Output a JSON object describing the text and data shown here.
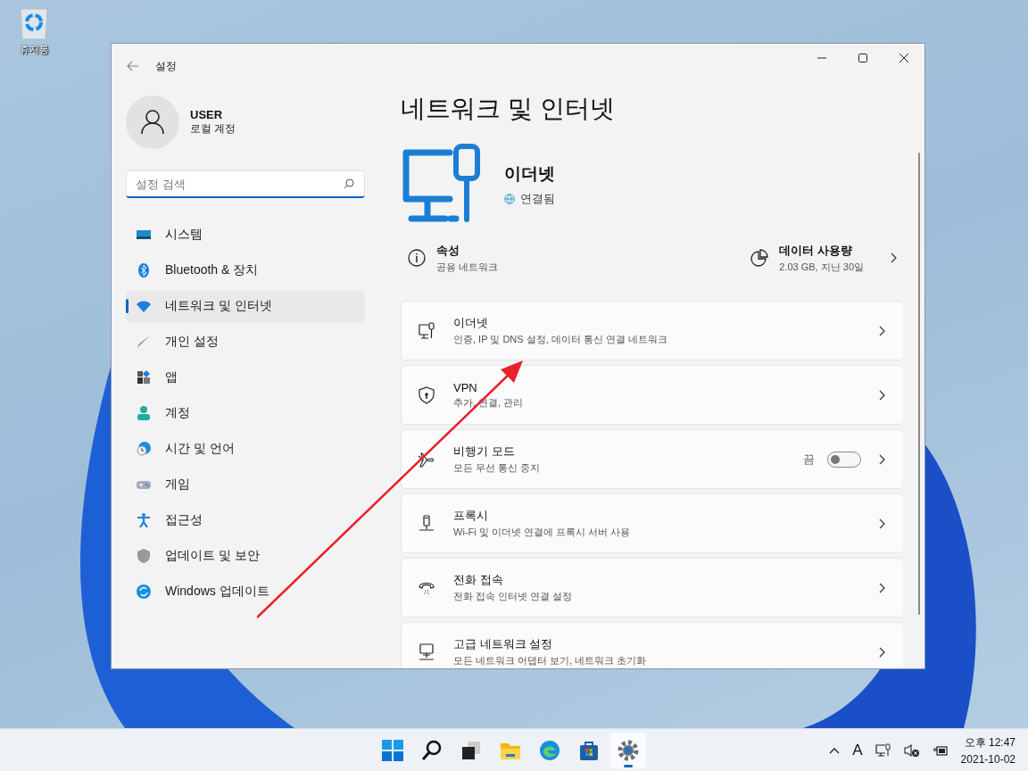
{
  "desktop": {
    "icons": [
      {
        "label": "휴지통"
      }
    ]
  },
  "window": {
    "title": "설정",
    "user": {
      "name": "USER",
      "account": "로컬 계정"
    },
    "search": {
      "placeholder": "설정 검색"
    },
    "nav": [
      {
        "label": "시스템",
        "selected": false
      },
      {
        "label": "Bluetooth & 장치",
        "selected": false
      },
      {
        "label": "네트워크 및 인터넷",
        "selected": true
      },
      {
        "label": "개인 설정",
        "selected": false
      },
      {
        "label": "앱",
        "selected": false
      },
      {
        "label": "계정",
        "selected": false
      },
      {
        "label": "시간 및 언어",
        "selected": false
      },
      {
        "label": "게임",
        "selected": false
      },
      {
        "label": "접근성",
        "selected": false
      },
      {
        "label": "업데이트 및 보안",
        "selected": false
      },
      {
        "label": "Windows 업데이트",
        "selected": false
      }
    ],
    "page_title": "네트워크 및 인터넷",
    "hero": {
      "name": "이더넷",
      "status": "연결됨"
    },
    "properties": {
      "title": "속성",
      "subtitle": "공용 네트워크"
    },
    "data_usage": {
      "title": "데이터 사용량",
      "subtitle": "2.03 GB, 지난 30일"
    },
    "settings": [
      {
        "kind": "link",
        "title": "이더넷",
        "subtitle": "인증, IP 및 DNS 설정, 데이터 통신 연결 네트워크"
      },
      {
        "kind": "link",
        "title": "VPN",
        "subtitle": "추가, 연결, 관리"
      },
      {
        "kind": "toggle",
        "title": "비행기 모드",
        "subtitle": "모든 무선 통신 중지",
        "toggle_label": "끔",
        "on": false
      },
      {
        "kind": "link",
        "title": "프록시",
        "subtitle": "Wi-Fi 및 이더넷 연결에 프록시 서버 사용"
      },
      {
        "kind": "link",
        "title": "전화 접속",
        "subtitle": "전화 접속 인터넷 연결 설정"
      },
      {
        "kind": "link",
        "title": "고급 네트워크 설정",
        "subtitle": "모든 네트워크 어댑터 보기, 네트워크 초기화"
      }
    ]
  },
  "taskbar": {
    "apps": [
      {
        "selected": false
      },
      {
        "selected": false
      },
      {
        "selected": false
      },
      {
        "selected": false
      },
      {
        "selected": false
      },
      {
        "selected": false
      },
      {
        "selected": true
      }
    ],
    "input_indicator": "A",
    "time": "오후 12:47",
    "date": "2021-10-02"
  }
}
